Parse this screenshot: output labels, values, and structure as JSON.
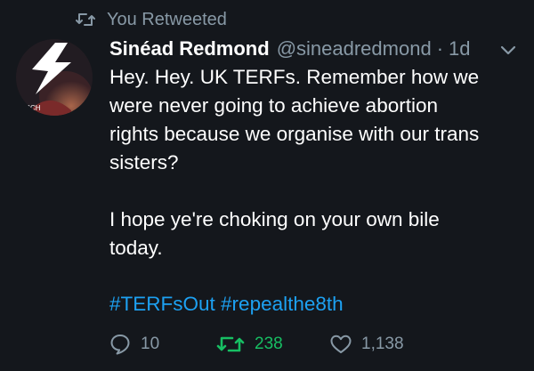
{
  "retweet_context": {
    "label": "You Retweeted",
    "icon": "retweet-icon"
  },
  "tweet": {
    "author_name": "Sinéad Redmond",
    "handle": "@sineadredmond",
    "separator": "·",
    "time": "1d",
    "lines": [
      "Hey. Hey. UK TERFs. Remember how we",
      "were never going to achieve abortion",
      "rights because we organise with our trans",
      "sisters?"
    ],
    "lines2": [
      "I hope ye're choking on your own bile",
      "today."
    ],
    "hashtags": [
      "#TERFsOut",
      "#repealthe8th"
    ],
    "avatar_badge": "+SCH"
  },
  "actions": {
    "reply_count": "10",
    "retweet_count": "238",
    "like_count": "1,138"
  },
  "colors": {
    "background": "#14171c",
    "muted": "#8899a6",
    "link": "#1da1f2",
    "retweeted": "#17bf63"
  }
}
